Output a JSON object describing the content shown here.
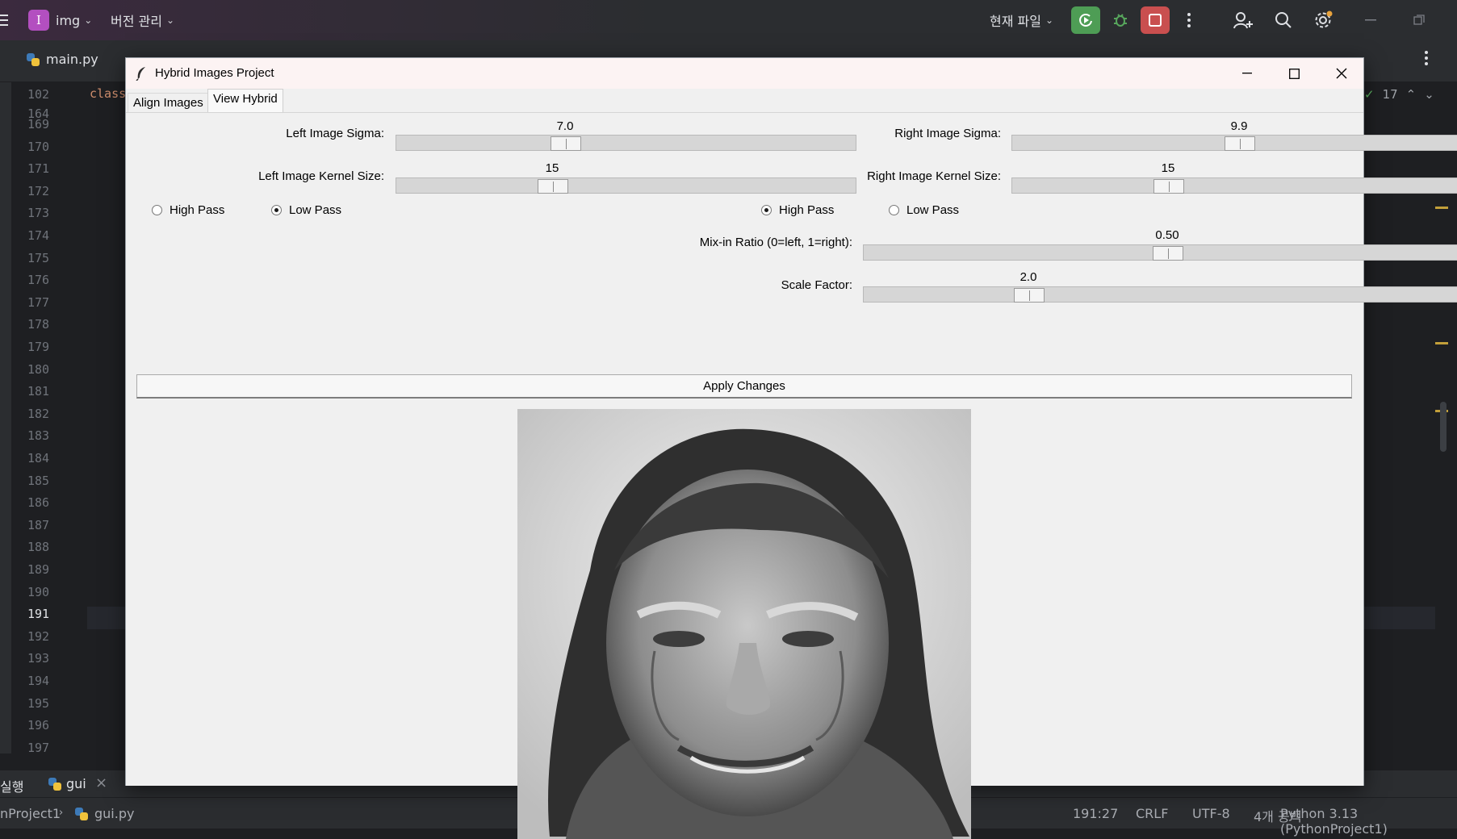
{
  "ide": {
    "project_badge": "I",
    "project_name": "img",
    "vcs_label": "버전 관리",
    "run_config": "현재 파일",
    "editor_tabs": [
      {
        "label": "main.py"
      }
    ],
    "inspection_count": "17",
    "line_numbers": [
      "102",
      "164",
      "169",
      "170",
      "171",
      "172",
      "173",
      "174",
      "175",
      "176",
      "177",
      "178",
      "179",
      "180",
      "181",
      "182",
      "183",
      "184",
      "185",
      "186",
      "187",
      "188",
      "189",
      "190",
      "191",
      "192",
      "193",
      "194",
      "195",
      "196",
      "197"
    ],
    "current_line": "191",
    "code_snippet": "class",
    "run_bar": {
      "run_label": "실행",
      "tab_label": "gui",
      "close_glyph": "×"
    },
    "status": {
      "breadcrumb_project": "nProject1",
      "breadcrumb_file": "gui.py",
      "caret": "191:27",
      "line_sep": "CRLF",
      "encoding": "UTF-8",
      "indent": "4개 공백",
      "interpreter": "Python 3.13 (PythonProject1)"
    }
  },
  "window": {
    "title": "Hybrid Images Project",
    "tabs": [
      {
        "label": "Align Images",
        "selected": false
      },
      {
        "label": "View Hybrid",
        "selected": true
      }
    ],
    "controls": {
      "left_sigma": {
        "label": "Left Image Sigma:",
        "value": "7.0",
        "fraction": 0.36
      },
      "right_sigma": {
        "label": "Right Image Sigma:",
        "value": "9.9",
        "fraction": 0.495
      },
      "left_kernel": {
        "label": "Left Image Kernel Size:",
        "value": "15",
        "fraction": 0.33
      },
      "right_kernel": {
        "label": "Right Image Kernel Size:",
        "value": "15",
        "fraction": 0.33
      },
      "left_filter": {
        "high": "High Pass",
        "low": "Low Pass",
        "selected": "low"
      },
      "right_filter": {
        "high": "High Pass",
        "low": "Low Pass",
        "selected": "high"
      },
      "mix_ratio": {
        "label": "Mix-in Ratio (0=left, 1=right):",
        "value": "0.50",
        "fraction": 0.5
      },
      "scale_factor": {
        "label": "Scale Factor:",
        "value": "2.0",
        "fraction": 0.26
      }
    },
    "apply_label": "Apply Changes"
  }
}
